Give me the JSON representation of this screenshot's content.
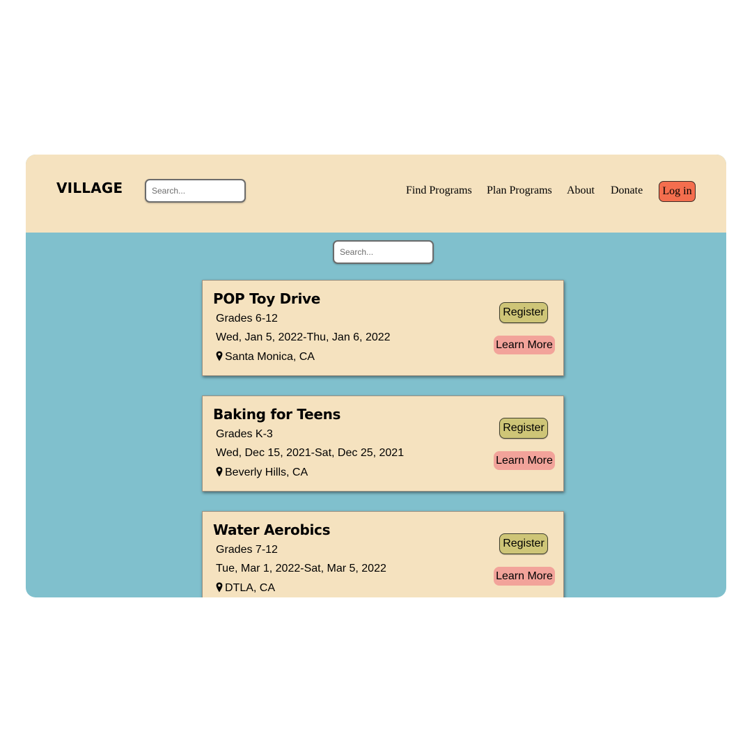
{
  "header": {
    "logo": "VILLAGE",
    "search_placeholder": "Search...",
    "nav": [
      "Find Programs",
      "Plan Programs",
      "About",
      "Donate"
    ],
    "login_label": "Log in"
  },
  "main": {
    "search_placeholder": "Search...",
    "programs": [
      {
        "title": "POP Toy Drive",
        "grades": "Grades 6-12",
        "dates": "Wed, Jan 5, 2022-Thu, Jan 6, 2022",
        "location": "Santa Monica, CA",
        "register_label": "Register",
        "learn_more_label": "Learn More"
      },
      {
        "title": "Baking for Teens",
        "grades": "Grades K-3",
        "dates": "Wed, Dec 15, 2021-Sat, Dec 25, 2021",
        "location": "Beverly Hills, CA",
        "register_label": "Register",
        "learn_more_label": "Learn More"
      },
      {
        "title": "Water Aerobics",
        "grades": "Grades 7-12",
        "dates": "Tue, Mar 1, 2022-Sat, Mar 5, 2022",
        "location": "DTLA, CA",
        "register_label": "Register",
        "learn_more_label": "Learn More"
      }
    ]
  },
  "colors": {
    "header_bg": "#f5e2bf",
    "content_bg": "#80c0cd",
    "card_bg": "#f5e2bf",
    "login_button": "#f46e4e",
    "register_button": "#cec577",
    "learn_more_button": "#f2a39a"
  },
  "icons": {
    "location": "map-pin-icon"
  }
}
